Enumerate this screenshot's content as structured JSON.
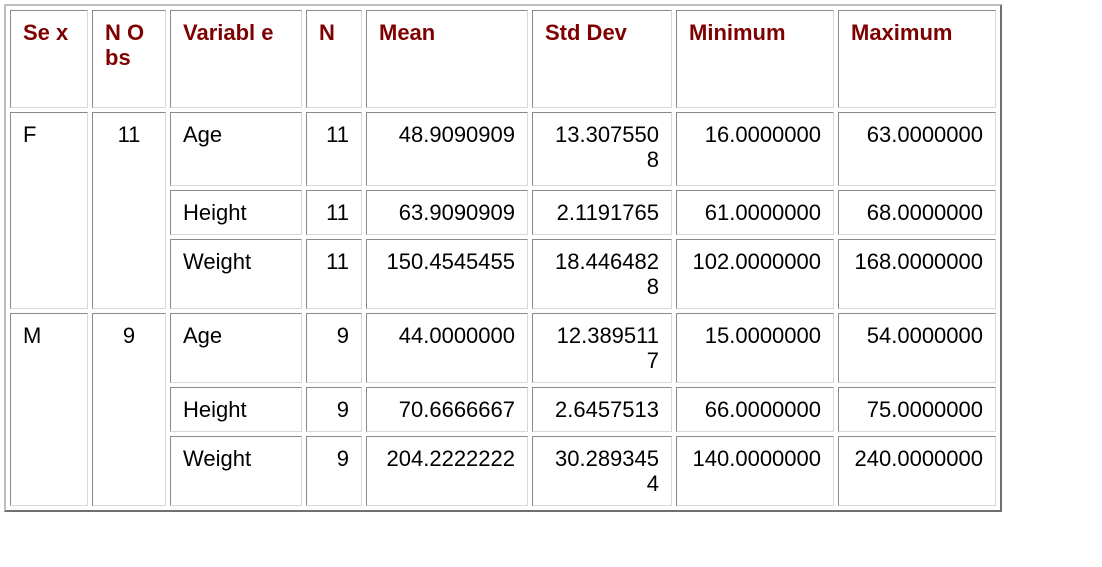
{
  "table": {
    "headers": [
      "Se x",
      "N O bs",
      "Variabl e",
      "N",
      "Mean",
      "Std Dev",
      "Minimum",
      "Maximum"
    ],
    "groups": [
      {
        "sex": "F",
        "nobs": "11",
        "rows": [
          {
            "variable": "Age",
            "n": "11",
            "mean": "48.9090909",
            "std": "13.3075508",
            "min": "16.0000000",
            "max": "63.0000000"
          },
          {
            "variable": "Height",
            "n": "11",
            "mean": "63.9090909",
            "std": "2.1191765",
            "min": "61.0000000",
            "max": "68.0000000"
          },
          {
            "variable": "Weight",
            "n": "11",
            "mean": "150.4545455",
            "std": "18.4464828",
            "min": "102.0000000",
            "max": "168.0000000"
          }
        ]
      },
      {
        "sex": "M",
        "nobs": "9",
        "rows": [
          {
            "variable": "Age",
            "n": "9",
            "mean": "44.0000000",
            "std": "12.3895117",
            "min": "15.0000000",
            "max": "54.0000000"
          },
          {
            "variable": "Height",
            "n": "9",
            "mean": "70.6666667",
            "std": "2.6457513",
            "min": "66.0000000",
            "max": "75.0000000"
          },
          {
            "variable": "Weight",
            "n": "9",
            "mean": "204.2222222",
            "std": "30.2893454",
            "min": "140.0000000",
            "max": "240.0000000"
          }
        ]
      }
    ]
  }
}
